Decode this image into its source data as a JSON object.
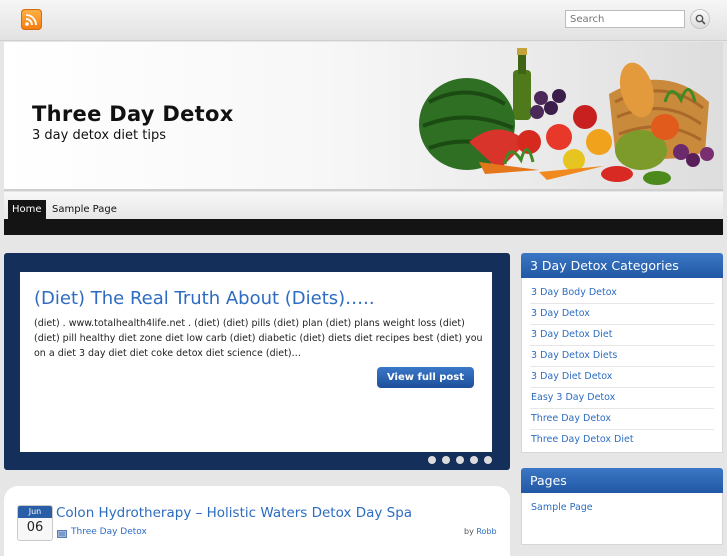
{
  "search": {
    "placeholder": "Search"
  },
  "site": {
    "title": "Three Day Detox",
    "tagline": "3 day detox diet tips"
  },
  "nav": [
    {
      "label": "Home"
    },
    {
      "label": "Sample Page"
    }
  ],
  "slider": {
    "title": "(Diet) The Real Truth About (Diets)…..",
    "excerpt": "(diet) . www.totalhealth4life.net . (diet) (diet) pills (diet) plan (diet) plans weight loss (diet) (diet) pill healthy diet zone diet low carb (diet) diabetic (diet) diets diet recipes best (diet) you on a diet 3 day diet diet coke detox diet science (diet)…",
    "button_label": "View full post",
    "slide_count": 5,
    "active_slide": 1
  },
  "post": {
    "month": "Jun",
    "day": "06",
    "title": "Colon Hydrotherapy – Holistic Waters Detox Day Spa",
    "category": "Three Day Detox",
    "by_label": "by",
    "author": "Robb"
  },
  "sidebar": {
    "categories_title": "3 Day Detox Categories",
    "categories": [
      "3 Day Body Detox",
      "3 Day Detox",
      "3 Day Detox Diet",
      "3 Day Detox Diets",
      "3 Day Diet Detox",
      "Easy 3 Day Detox",
      "Three Day Detox",
      "Three Day Detox Diet"
    ],
    "pages_title": "Pages",
    "pages": [
      "Sample Page"
    ]
  },
  "icons": {
    "rss": "rss-icon",
    "search": "search-icon",
    "category": "folder-icon",
    "header_image": "fruits-vegetables-illustration"
  },
  "colors": {
    "accent": "#2d6cc0",
    "slider_bg": "#14305a",
    "nav_dark": "#141414",
    "rss": "#f47b0d"
  }
}
